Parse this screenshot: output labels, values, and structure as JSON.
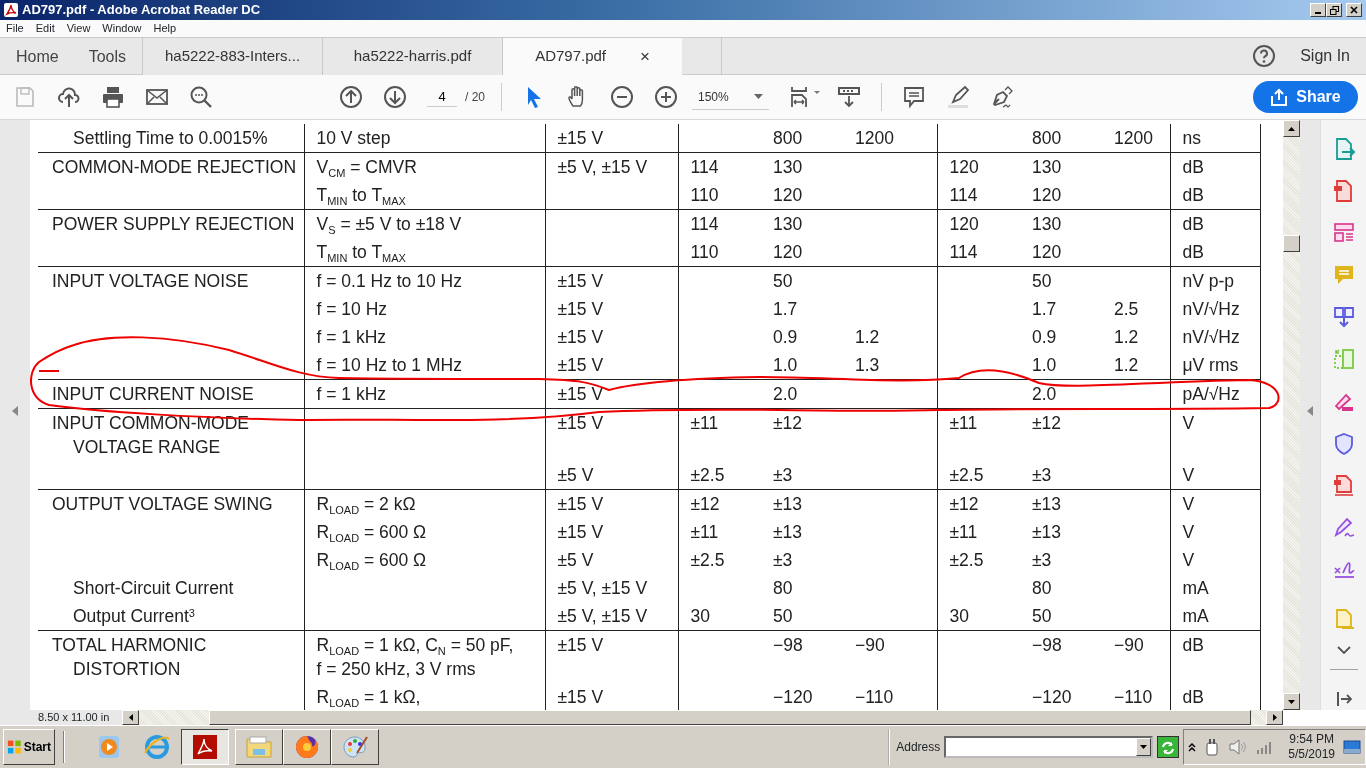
{
  "window": {
    "title": "AD797.pdf - Adobe Acrobat Reader DC"
  },
  "menu": [
    "File",
    "Edit",
    "View",
    "Window",
    "Help"
  ],
  "home_tools": [
    "Home",
    "Tools"
  ],
  "tabs": [
    {
      "label": "ha5222-883-Inters...",
      "selected": false
    },
    {
      "label": "ha5222-harris.pdf",
      "selected": false
    },
    {
      "label": "AD797.pdf",
      "selected": true,
      "close": "×"
    }
  ],
  "sign_in": "Sign In",
  "toolbar": {
    "tools": [
      {
        "kind": "select",
        "selected": true
      },
      {
        "kind": "hand",
        "selected": false
      }
    ],
    "page": "4",
    "page_total": "/ 20",
    "zoom": "150%",
    "share": "Share"
  },
  "document": {
    "groups": [
      {
        "rows": [
          {
            "kind": "sub",
            "column_1": "Settling Time to 0.0015%",
            "column_2": "10 V step",
            "column_3": "±15 V",
            "column_5": "800",
            "column_6": "1200",
            "column_8": "800",
            "column_9": "1200",
            "column_10": "ns"
          }
        ]
      },
      {
        "rows": [
          {
            "kind": "main",
            "column_1": "COMMON-MODE REJECTION",
            "column_2": "V$_{CM}$ = CMVR",
            "column_3": "±5 V, ±15 V",
            "column_4": "114",
            "column_5": "130",
            "column_7": "120",
            "column_8": "130",
            "column_10": "dB"
          },
          {
            "kind": "main",
            "column_2": "T$_{MIN}$ to T$_{MAX}$",
            "column_4": "110",
            "column_5": "120",
            "column_7": "114",
            "column_8": "120",
            "column_10": "dB"
          }
        ]
      },
      {
        "rows": [
          {
            "kind": "main",
            "column_1": "POWER SUPPLY REJECTION",
            "column_2": "V$_{S}$ = ±5 V to ±18 V",
            "column_4": "114",
            "column_5": "130",
            "column_7": "120",
            "column_8": "130",
            "column_10": "dB"
          },
          {
            "kind": "main",
            "column_2": "T$_{MIN}$ to T$_{MAX}$",
            "column_4": "110",
            "column_5": "120",
            "column_7": "114",
            "column_8": "120",
            "column_10": "dB"
          }
        ]
      },
      {
        "rows": [
          {
            "kind": "main",
            "column_1": "INPUT VOLTAGE NOISE",
            "column_2": "f = 0.1 Hz to 10 Hz",
            "column_3": "±15 V",
            "column_5": "50",
            "column_8": "50",
            "column_10": "nV p-p"
          },
          {
            "kind": "main",
            "column_2": "f = 10 Hz",
            "column_3": "±15 V",
            "column_5": "1.7",
            "column_8": "1.7",
            "column_9": "2.5",
            "column_10": "nV/√Hz"
          },
          {
            "kind": "main",
            "column_2": "f = 1 kHz",
            "column_3": "±15 V",
            "column_5": "0.9",
            "column_6": "1.2",
            "column_8": "0.9",
            "column_9": "1.2",
            "column_10": "nV/√Hz"
          },
          {
            "kind": "main",
            "column_2": "f = 10 Hz to 1 MHz",
            "column_3": "±15 V",
            "column_5": "1.0",
            "column_6": "1.3",
            "column_8": "1.0",
            "column_9": "1.2",
            "column_10": "μV rms"
          }
        ]
      },
      {
        "rows": [
          {
            "kind": "main",
            "column_1": "INPUT CURRENT NOISE",
            "column_2": "f = 1 kHz",
            "column_3": "±15 V",
            "column_5": "2.0",
            "column_8": "2.0",
            "column_10": "pA/√Hz"
          }
        ]
      },
      {
        "rows": [
          {
            "kind": "main",
            "column_1": "INPUT COMMON-MODE\nVOLTAGE RANGE",
            "column_3": "±15 V",
            "column_4": "±11",
            "column_5": "±12",
            "column_7": "±11",
            "column_8": "±12",
            "column_10": "V"
          },
          {
            "kind": "main",
            "column_3": "±5 V",
            "column_4": "±2.5",
            "column_5": "±3",
            "column_7": "±2.5",
            "column_8": "±3",
            "column_10": "V"
          }
        ]
      },
      {
        "rows": [
          {
            "kind": "main",
            "column_1": "OUTPUT VOLTAGE SWING",
            "column_2": "R$_{LOAD}$ = 2 kΩ",
            "column_3": "±15 V",
            "column_4": "±12",
            "column_5": "±13",
            "column_7": "±12",
            "column_8": "±13",
            "column_10": "V"
          },
          {
            "kind": "main",
            "column_2": "R$_{LOAD}$ = 600 Ω",
            "column_3": "±15 V",
            "column_4": "±11",
            "column_5": "±13",
            "column_7": "±11",
            "column_8": "±13",
            "column_10": "V"
          },
          {
            "kind": "main",
            "column_2": "R$_{LOAD}$ = 600 Ω",
            "column_3": "±5 V",
            "column_4": "±2.5",
            "column_5": "±3",
            "column_7": "±2.5",
            "column_8": "±3",
            "column_10": "V"
          },
          {
            "kind": "sub",
            "column_1": "Short-Circuit Current",
            "column_3": "±5 V, ±15 V",
            "column_5": "80",
            "column_8": "80",
            "column_10": "mA"
          },
          {
            "kind": "sub",
            "column_1": "Output Current$^{3}$",
            "column_3": "±5 V, ±15 V",
            "column_4": "30",
            "column_5": "50",
            "column_7": "30",
            "column_8": "50",
            "column_10": "mA"
          }
        ]
      },
      {
        "rows": [
          {
            "kind": "main",
            "column_1": "TOTAL HARMONIC\nDISTORTION",
            "column_2": "R$_{LOAD}$ = 1 kΩ, C$_{N}$ = 50 pF,\nf = 250 kHz, 3 V rms",
            "column_3": "±15 V",
            "column_5": "−98",
            "column_6": "−90",
            "column_8": "−98",
            "column_9": "−90",
            "column_10": "dB"
          },
          {
            "kind": "main",
            "column_2": "R$_{LOAD}$ = 1 kΩ,",
            "column_3": "±15 V",
            "column_5": "−120",
            "column_6": "−110",
            "column_8": "−120",
            "column_9": "−110",
            "column_10": "dB"
          }
        ]
      }
    ]
  },
  "status": {
    "page_size": "8.50 x 11.00 in"
  },
  "taskbar": {
    "start": "Start",
    "apps": [
      {
        "kind": "media",
        "selected": false
      },
      {
        "kind": "browser",
        "selected": false
      },
      {
        "kind": "reader",
        "selected": true
      },
      {
        "kind": "folder",
        "selected": false
      },
      {
        "kind": "firefox",
        "selected": false
      },
      {
        "kind": "paint",
        "selected": false
      }
    ],
    "address_label": "Address",
    "time": "9:54 PM",
    "date": "5/5/2019"
  }
}
